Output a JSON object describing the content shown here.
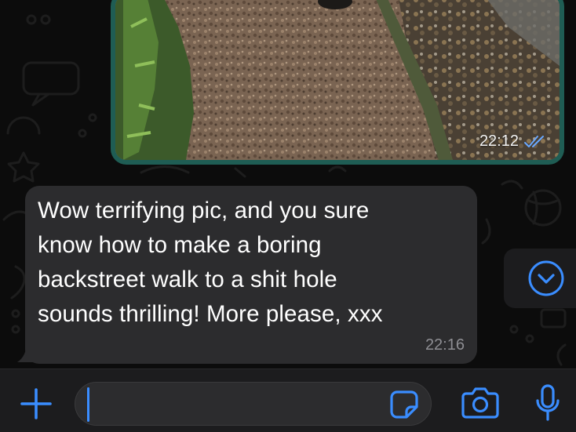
{
  "image_message": {
    "time": "22:12",
    "status": "read-double-check-icon"
  },
  "text_message": {
    "text": "Wow terrifying pic, and you sure\nknow how to make a boring\nbackstreet walk to a shit hole\nsounds thrilling! More please, xxx",
    "time": "22:16"
  },
  "composer": {
    "input_value": "",
    "icons": [
      "plus-icon",
      "sticker-icon",
      "camera-icon",
      "microphone-icon"
    ]
  },
  "colors": {
    "accent": "#3a8dff",
    "outgoing_bubble": "#1f5d54",
    "incoming_bubble": "#2c2c2e"
  }
}
